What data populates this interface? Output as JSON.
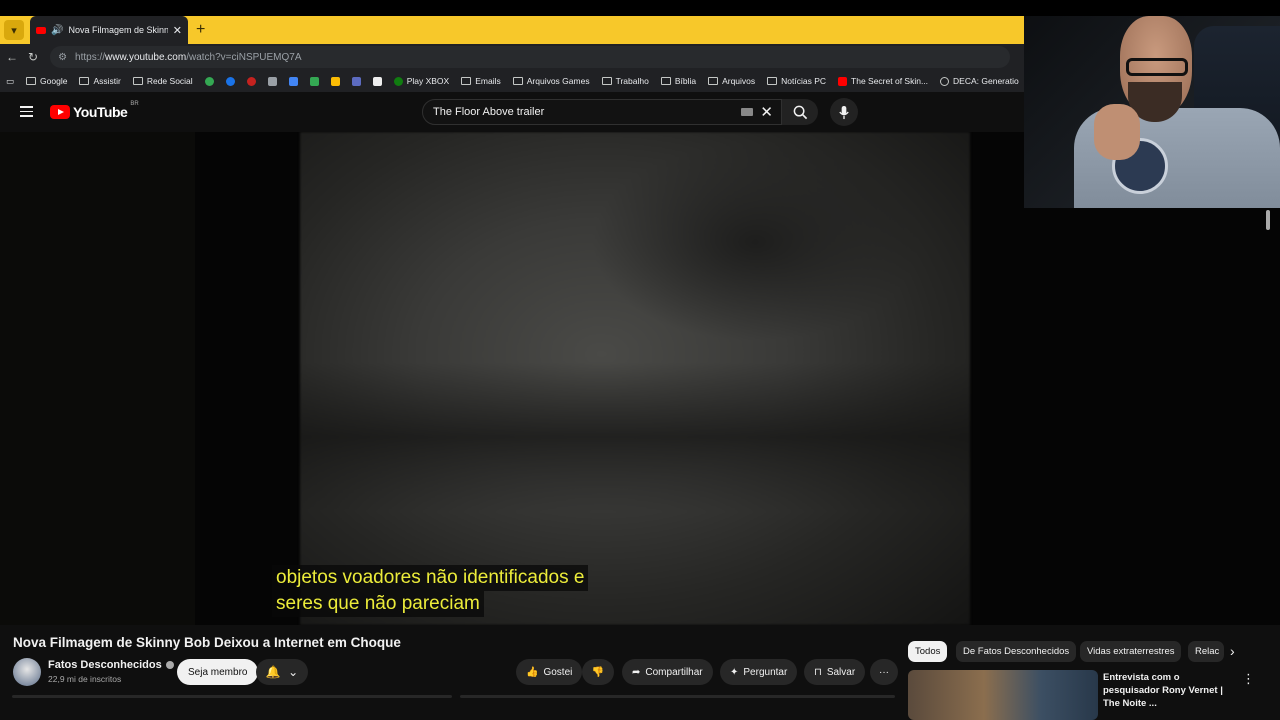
{
  "browser": {
    "tab_title": "Nova Filmagem de Skinny Bob",
    "url_prefix": "https://",
    "url_host": "www.youtube.com",
    "url_path": "/watch?v=ciNSPUEMQ7A",
    "bookmarks": [
      "Google",
      "Assistir",
      "Rede Social",
      "Play XBOX",
      "Emails",
      "Arquivos Games",
      "Trabalho",
      "Bíblia",
      "Arquivos",
      "Notícias PC",
      "The Secret of Skin...",
      "DECA: Generatio"
    ]
  },
  "youtube": {
    "logo_text": "YouTube",
    "logo_region": "BR",
    "search_value": "The Floor Above trailer"
  },
  "video": {
    "caption_line1": "objetos voadores não identificados e",
    "caption_line2": "seres que não pareciam"
  },
  "info": {
    "title": "Nova Filmagem de Skinny Bob Deixou a Internet em Choque",
    "channel_name": "Fatos Desconhecidos",
    "subscribers": "22,9 mi de inscritos",
    "member_label": "Seja membro",
    "like_label": "Gostei",
    "share_label": "Compartilhar",
    "ask_label": "Perguntar",
    "save_label": "Salvar",
    "more_label": "···"
  },
  "sidebar": {
    "chips": [
      "Todos",
      "De Fatos Desconhecidos",
      "Vidas extraterrestres",
      "Relac"
    ],
    "related_title": "Entrevista com o pesquisador Rony Vernet | The Noite ..."
  },
  "colors": {
    "tabbar": "#f7c82a",
    "caption_text": "#ecec3a",
    "yt_red": "#ff0000"
  }
}
